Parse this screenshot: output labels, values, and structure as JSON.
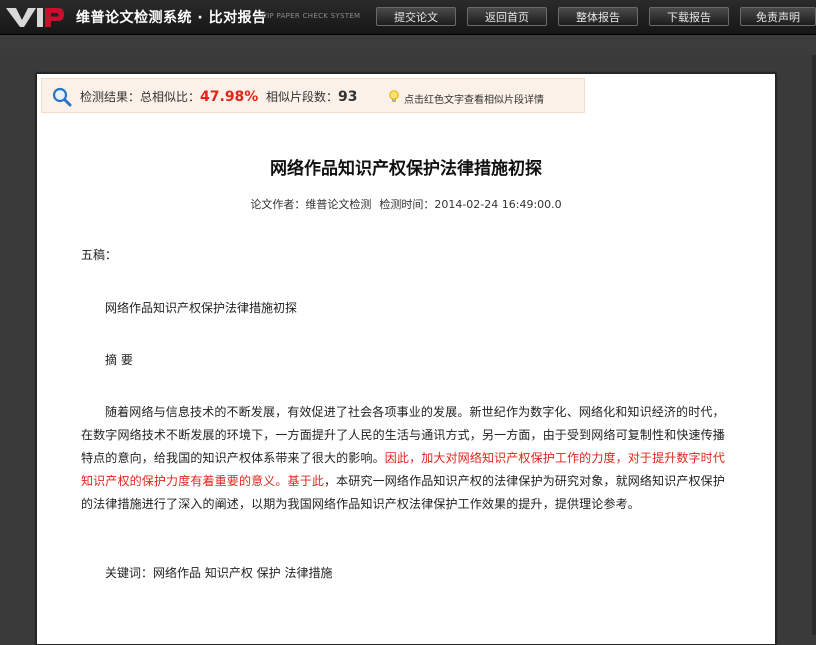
{
  "header": {
    "logo_text": "VIP",
    "brand": "维普论文检测系统 · 比对报告",
    "brand_en": "VIP PAPER CHECK SYSTEM",
    "nav": [
      {
        "label": "提交论文"
      },
      {
        "label": "返回首页"
      },
      {
        "label": "整体报告"
      },
      {
        "label": "下载报告"
      },
      {
        "label": "免责声明"
      }
    ]
  },
  "result": {
    "prefix": "检测结果：总相似比：",
    "percent": "47.98%",
    "segments_label": "相似片段数：",
    "segments": "93",
    "hint": "点击红色文字查看相似片段详情"
  },
  "document": {
    "title": "网络作品知识产权保护法律措施初探",
    "author": "论文作者：维普论文检测",
    "time": "检测时间：2014-02-24 16:49:00.0",
    "draft": "五稿：",
    "subtitle": "网络作品知识产权保护法律措施初探",
    "abstract_heading": "摘 要",
    "para_part1": "随着网络与信息技术的不断发展，有效促进了社会各项事业的发展。新世纪作为数字化、网络化和知识经济的时代，在数字网络技术不断发展的环境下，一方面提升了人民的生活与通讯方式，另一方面，由于受到网络可复制性和快速传播特点的意向，给我国的知识产权体系带来了很大的影响。",
    "para_red": "因此，加大对网络知识产权保护工作的力度，对于提升数字时代知识产权的保护力度有着重要的意义。基于此",
    "para_part2": "，本研究一网络作品知识产权的法律保护为研究对象，就网络知识产权保护的法律措施进行了深入的阐述，以期为我国网络作品知识产权法律保护工作效果的提升，提供理论参考。",
    "keywords": "关键词：网络作品 知识产权 保护 法律措施"
  },
  "colors": {
    "accent_red": "#e0261b",
    "topbar": "#1f1f1f",
    "result_bg": "#fbf1e8"
  },
  "icons": {
    "search": "search-icon",
    "hint": "lightbulb-icon"
  }
}
